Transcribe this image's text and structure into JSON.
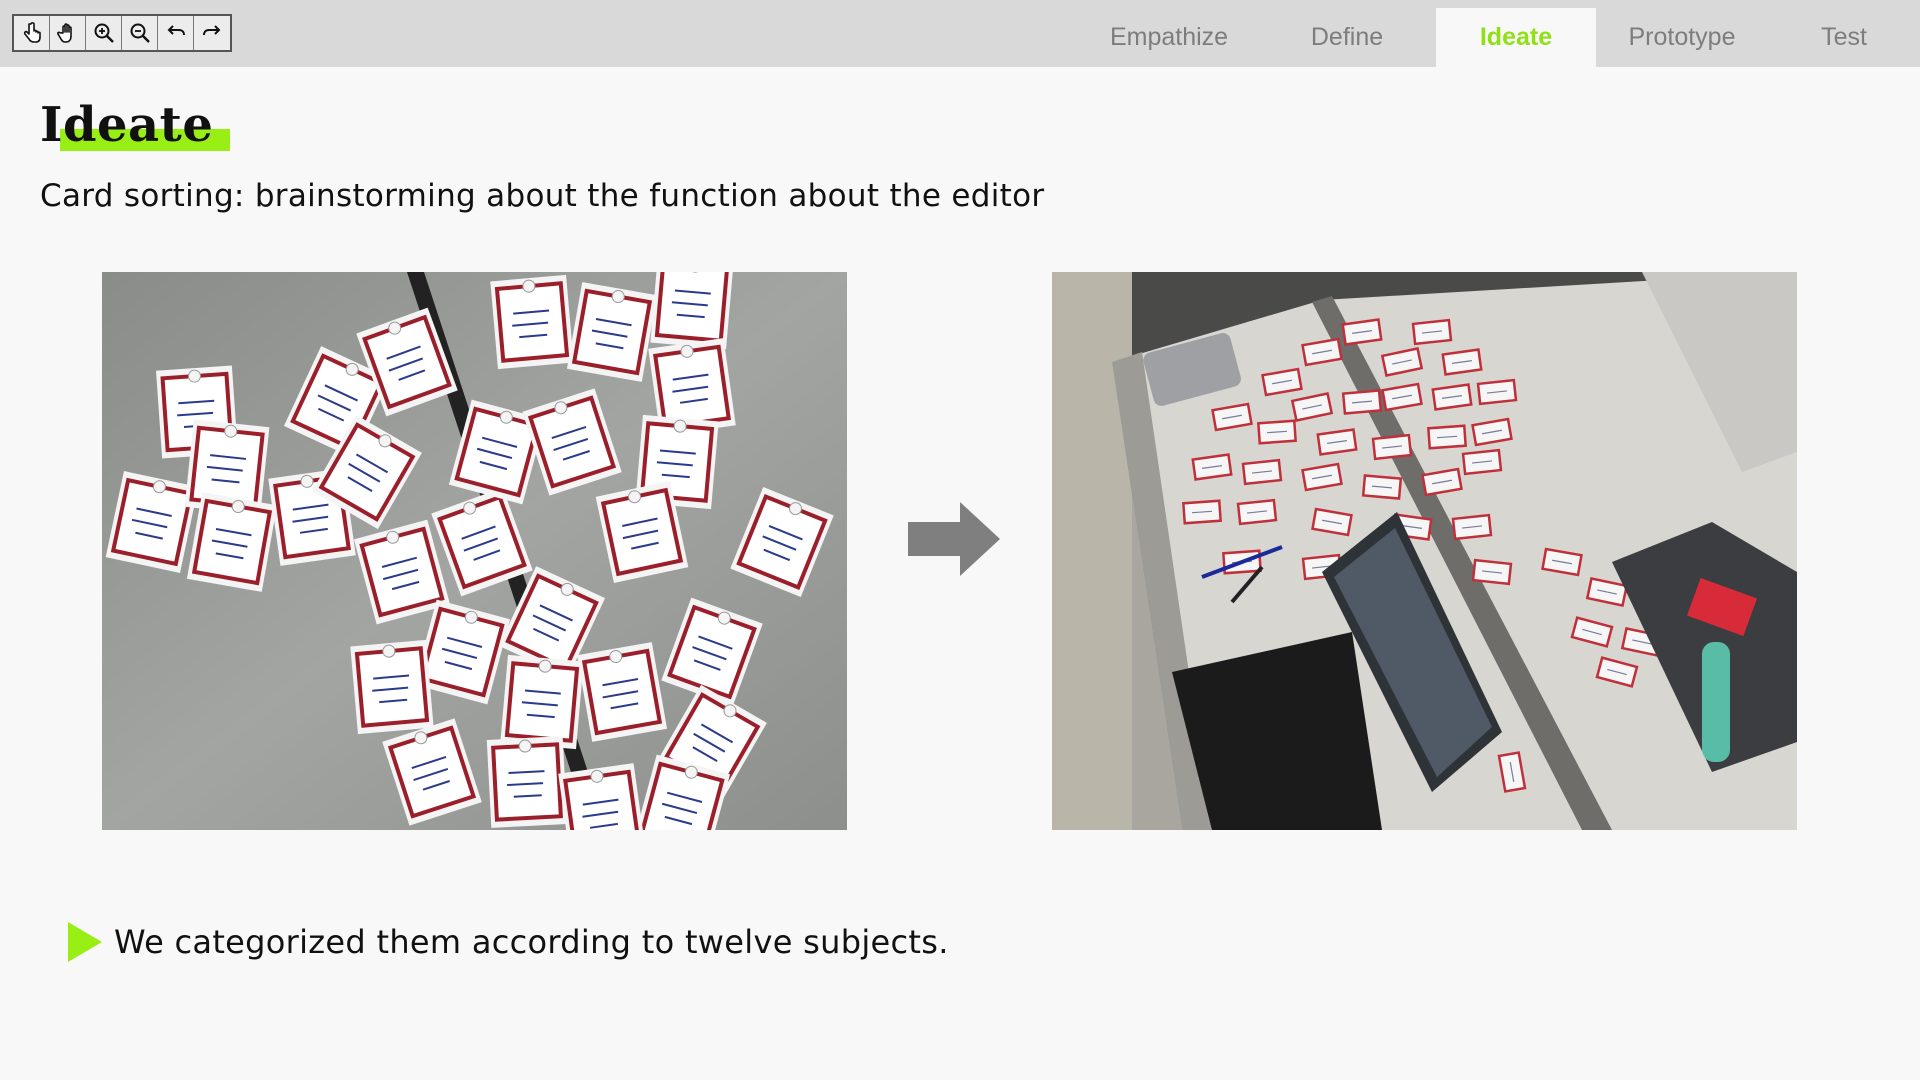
{
  "toolbar": {
    "tools": [
      {
        "name": "pointer-tool",
        "icon": "pointer-hand-icon"
      },
      {
        "name": "pan-tool",
        "icon": "hand-icon"
      },
      {
        "name": "zoom-in-tool",
        "icon": "zoom-in-icon"
      },
      {
        "name": "zoom-out-tool",
        "icon": "zoom-out-icon"
      },
      {
        "name": "undo-tool",
        "icon": "undo-icon"
      },
      {
        "name": "redo-tool",
        "icon": "redo-icon"
      }
    ]
  },
  "tabs": [
    {
      "label": "Empathize"
    },
    {
      "label": "Define"
    },
    {
      "label": "Ideate",
      "active": true
    },
    {
      "label": "Prototype"
    },
    {
      "label": "Test"
    }
  ],
  "colors": {
    "accent": "#99ee16",
    "active_tab_text": "#8fe017",
    "arrow": "#7f7f7f"
  },
  "page": {
    "title": "Ideate",
    "subtitle": "Card sorting: brainstorming about the function about the editor",
    "note": "We categorized them according to twelve subjects."
  }
}
